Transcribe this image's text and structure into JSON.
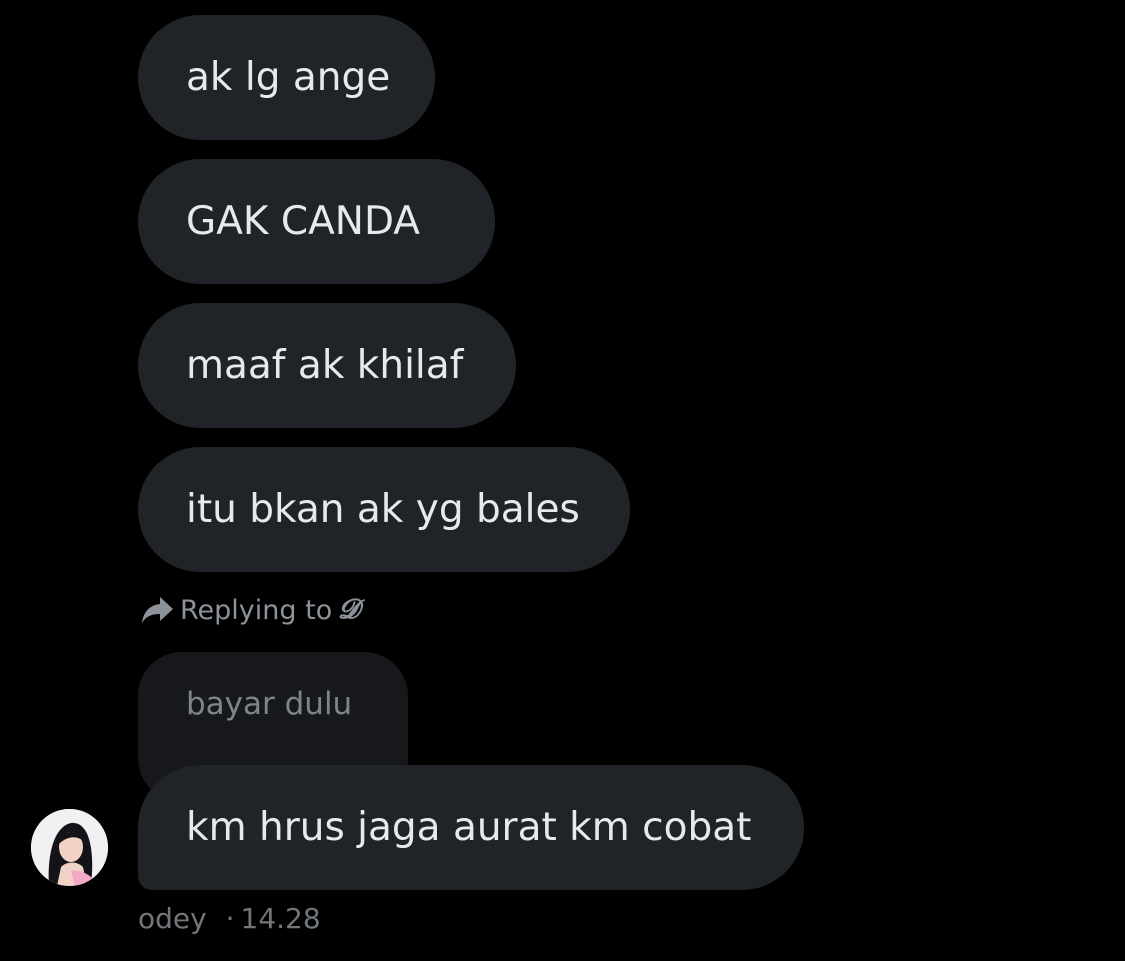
{
  "messages": [
    {
      "text": "ak lg ange"
    },
    {
      "text": "GAK CANDA"
    },
    {
      "text": "maaf ak khilaf"
    },
    {
      "text": "itu bkan ak yg bales"
    }
  ],
  "reply": {
    "label": "Replying to",
    "name": "𝓓",
    "quoted_text": "bayar dulu",
    "message_text": "km hrus jaga aurat km cobat"
  },
  "sender": {
    "name": "odey",
    "separator": "·",
    "time": "14.28"
  },
  "colors": {
    "background": "#000000",
    "bubble": "#202327",
    "quoted_bubble": "#16181b",
    "text": "#e7e9ea",
    "muted": "#71767b"
  },
  "icons": [
    "reply-arrow-icon"
  ]
}
